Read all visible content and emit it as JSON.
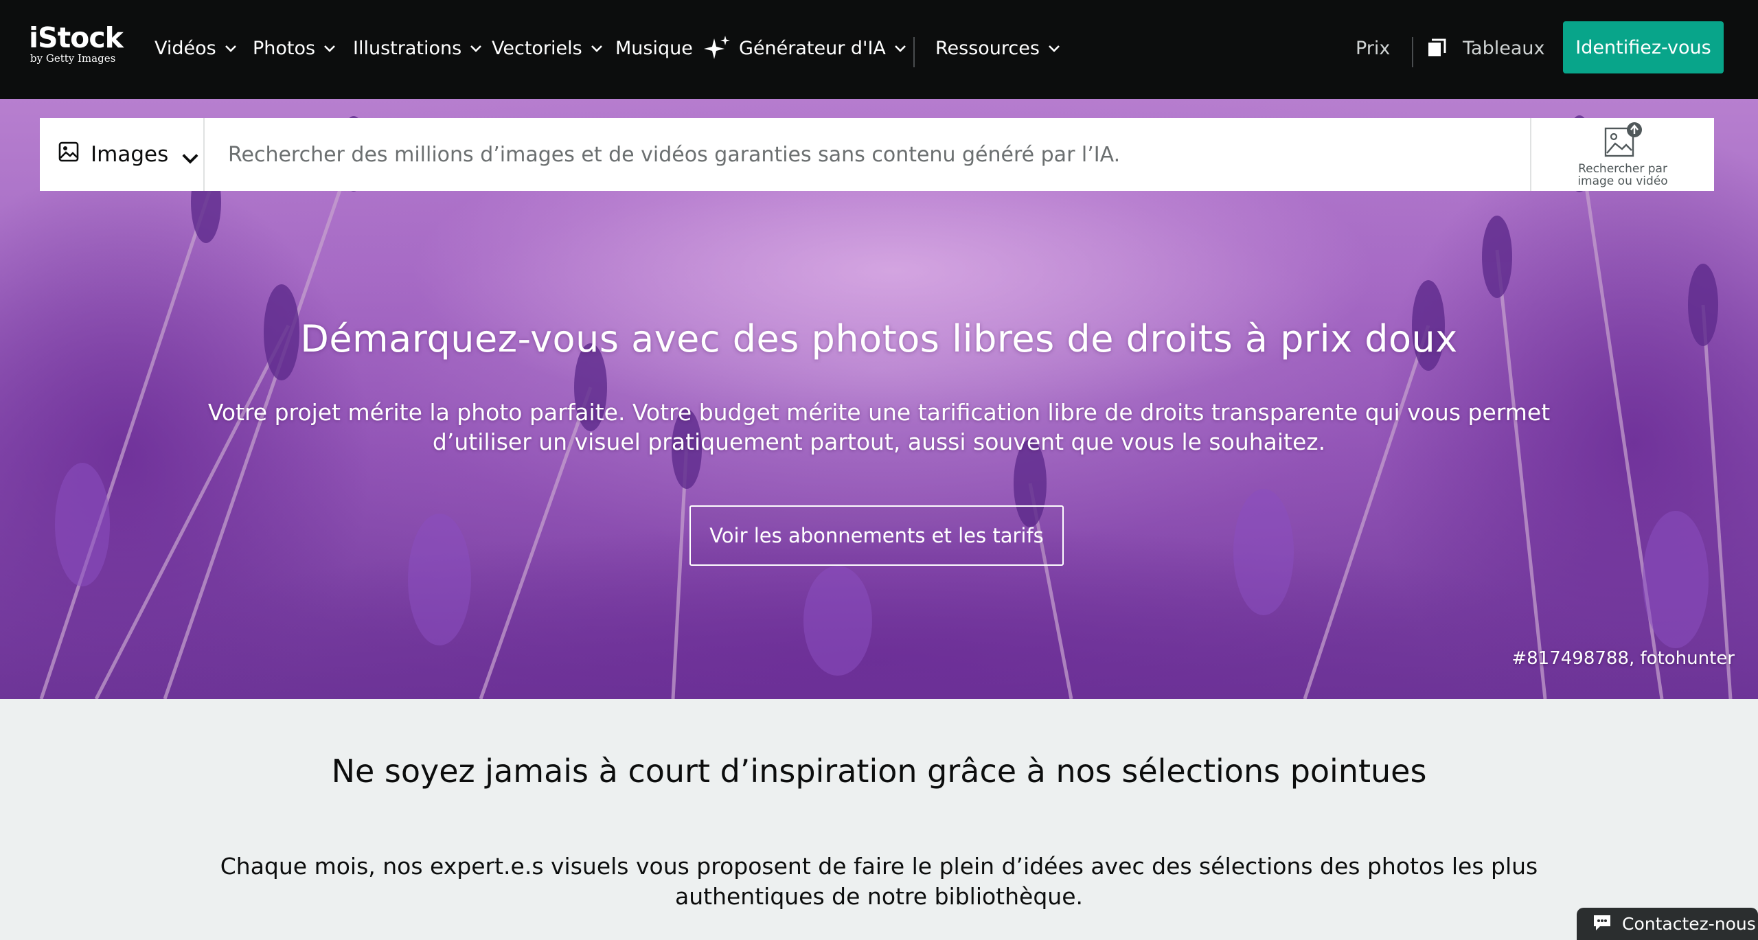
{
  "logo": {
    "wordmark": "iStock",
    "subline": "by Getty Images"
  },
  "nav": {
    "items": [
      {
        "label": "Vidéos"
      },
      {
        "label": "Photos"
      },
      {
        "label": "Illustrations"
      },
      {
        "label": "Vectoriels"
      },
      {
        "label": "Musique"
      },
      {
        "label": "Générateur d'IA",
        "icon": "sparkle-icon"
      },
      {
        "label": "Ressources"
      }
    ],
    "pricing": "Prix",
    "boards": "Tableaux",
    "signin": "Identifiez-vous"
  },
  "search": {
    "media_type": "Images",
    "placeholder": "Rechercher des millions d’images et de vidéos garanties sans contenu généré par l’IA.",
    "visual_search_label": "Rechercher par image ou vidéo"
  },
  "hero": {
    "title": "Démarquez-vous avec des photos libres de droits à prix doux",
    "subtitle": "Votre projet mérite la photo parfaite. Votre budget mérite une tarification libre de droits transparente qui vous permet d’utiliser un visuel pratiquement partout, aussi souvent que vous le souhaitez.",
    "cta": "Voir les abonnements et les tarifs",
    "credit": "#817498788, fotohunter"
  },
  "inspiration": {
    "title": "Ne soyez jamais à court d’inspiration grâce à nos sélections pointues",
    "text": "Chaque mois, nos expert.e.s visuels vous proposent de faire le plein d’idées avec des sélections des photos les plus authentiques de notre bibliothèque."
  },
  "contact": {
    "label": "Contactez-nous"
  },
  "colors": {
    "nav_bg": "#0c0d0d",
    "accent": "#08a58a",
    "hero_purple": "#9a5ec0",
    "page_bg": "#edf0f0"
  }
}
